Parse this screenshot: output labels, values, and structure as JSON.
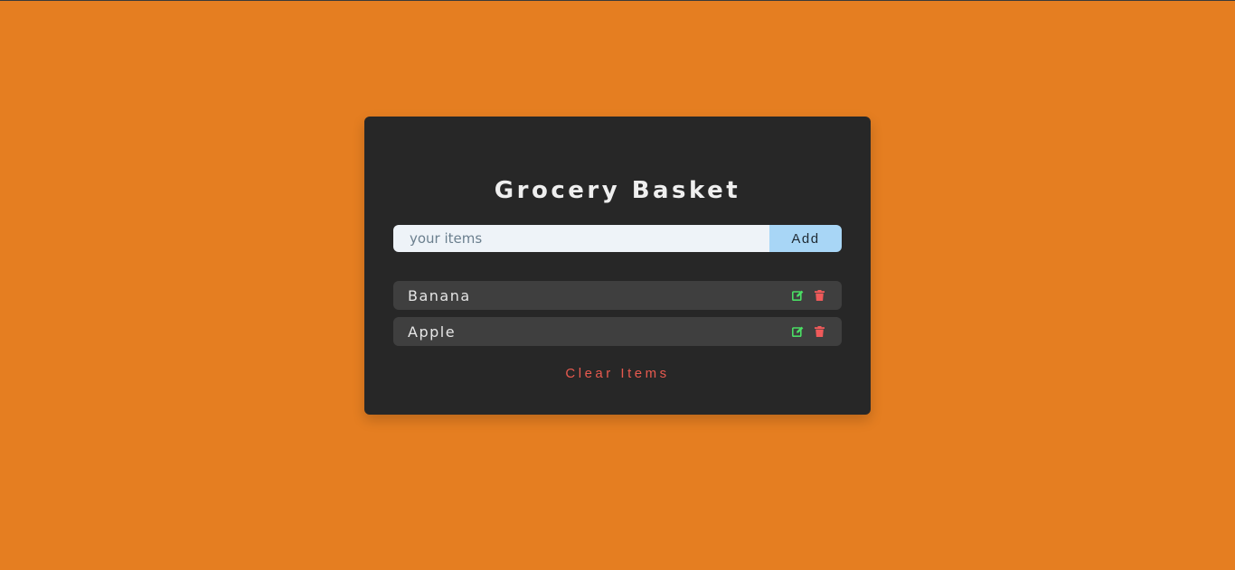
{
  "app": {
    "title": "Grocery Basket"
  },
  "form": {
    "placeholder": "your items",
    "value": "",
    "add_label": "Add"
  },
  "items": [
    {
      "label": "Banana",
      "edit_icon": "edit-icon",
      "delete_icon": "trash-icon"
    },
    {
      "label": "Apple",
      "edit_icon": "edit-icon",
      "delete_icon": "trash-icon"
    }
  ],
  "footer": {
    "clear_label": "Clear Items"
  },
  "colors": {
    "background": "#e57e21",
    "card": "#272727",
    "item": "#3f3f3f",
    "input": "#eef3f8",
    "add_button": "#a8d6f6",
    "edit_icon": "#4ade64",
    "delete_icon": "#ef5a5a",
    "clear_text": "#e85a4f"
  }
}
